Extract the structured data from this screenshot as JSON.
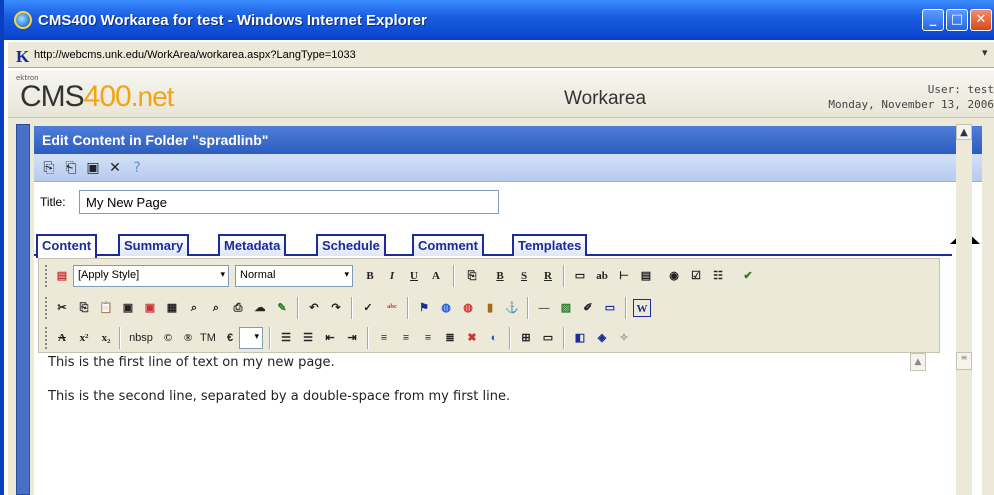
{
  "window": {
    "title": "CMS400 Workarea for test - Windows Internet Explorer",
    "controls": {
      "minimize": "_",
      "maximize": "□",
      "close": "✕"
    }
  },
  "address": {
    "k_icon": "K",
    "url": "http://webcms.unk.edu/WorkArea/workarea.aspx?LangType=1033"
  },
  "banner": {
    "ektron": "ektron",
    "logo_cms": "CMS",
    "logo_num": "400",
    "logo_net": ".net",
    "workarea": "Workarea",
    "user": "User: test",
    "date": "Monday, November 13, 2006"
  },
  "panel": {
    "heading": "Edit Content in Folder \"spradlinb\"",
    "title_label": "Title:",
    "title_value": "My New Page"
  },
  "tabs": [
    "Content",
    "Summary",
    "Metadata",
    "Schedule",
    "Comment",
    "Templates"
  ],
  "toolbar": {
    "style_select": "[Apply Style]",
    "format_select": "Normal",
    "bold": "B",
    "italic": "I",
    "underline": "U",
    "font_color": "A",
    "row3_nbsp": "nbsp",
    "row3_tm": "TM",
    "row3_euro": "€"
  },
  "editor": {
    "line1": "This is the first line of text on my new page.",
    "line2": "This is the second line, separated by a double-space from my first line."
  },
  "colors": {
    "titlebar": "#0a47d0",
    "panel_header": "#2b5cc0",
    "tab_border": "#1b2b9a",
    "accent_orange": "#f4a318"
  }
}
